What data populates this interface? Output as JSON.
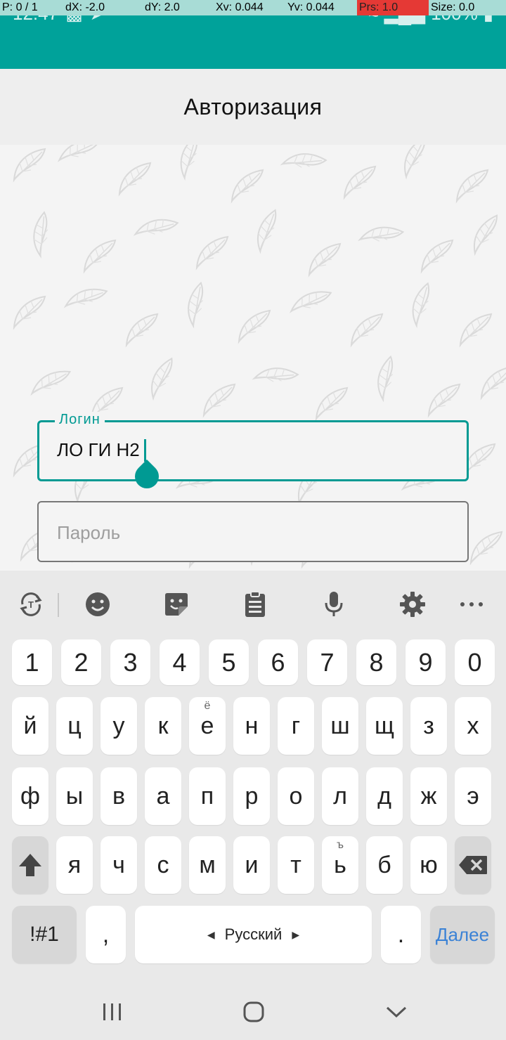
{
  "debug": {
    "pointer": "P: 0 / 1",
    "dx": "dX: -2.0",
    "dy": "dY: 2.0",
    "xv": "Xv: 0.044",
    "yv": "Yv: 0.044",
    "prs": "Prs: 1.0",
    "size": "Size: 0.0"
  },
  "status": {
    "time": "12:47",
    "battery": "100%"
  },
  "header": {
    "title": "Авторизация"
  },
  "form": {
    "login_label": "Логин",
    "login_value": "ЛО ГИ Н2",
    "password_placeholder": "Пароль"
  },
  "keyboard": {
    "numbers": [
      "1",
      "2",
      "3",
      "4",
      "5",
      "6",
      "7",
      "8",
      "9",
      "0"
    ],
    "row1": [
      "й",
      "ц",
      "у",
      "к",
      "е",
      "н",
      "г",
      "ш",
      "щ",
      "з",
      "х"
    ],
    "row1_hint_e": "ё",
    "row2": [
      "ф",
      "ы",
      "в",
      "а",
      "п",
      "р",
      "о",
      "л",
      "д",
      "ж",
      "э"
    ],
    "row3": [
      "я",
      "ч",
      "с",
      "м",
      "и",
      "т",
      "ь",
      "б",
      "ю"
    ],
    "row3_hint_soft": "ъ",
    "symbols_key": "!#1",
    "comma_key": ",",
    "space_label": "Русский",
    "period_key": ".",
    "action_key": "Далее"
  }
}
